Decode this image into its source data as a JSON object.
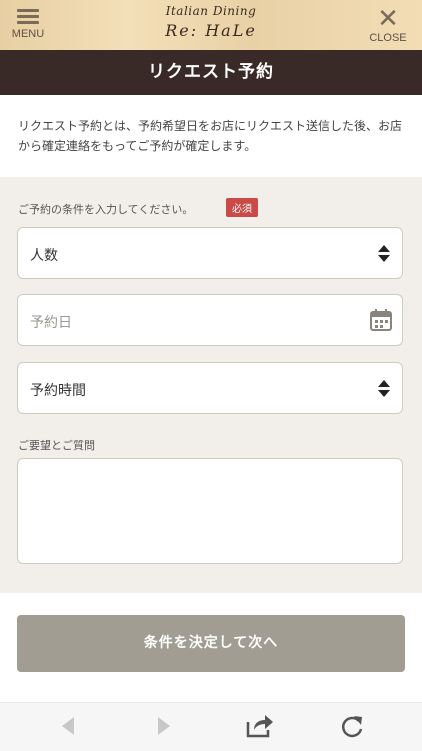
{
  "header": {
    "menu_label": "MENU",
    "logo_line1": "Italian Dining",
    "logo_line2": "Re: HaLe",
    "close_label": "CLOSE"
  },
  "page_title": "リクエスト予約",
  "intro_text": "リクエスト予約とは、予約希望日をお店にリクエスト送信した後、お店から確定連絡をもってご予約が確定します。",
  "form": {
    "conditions_label": "ご予約の条件を入力してください。",
    "required_badge": "必須",
    "people_select": "人数",
    "date_placeholder": "予約日",
    "time_select": "予約時間",
    "requests_label": "ご要望とご質問",
    "requests_value": ""
  },
  "submit_label": "条件を決定して次へ",
  "browser_nav": {
    "icons": [
      "back-arrow-icon",
      "forward-arrow-icon",
      "share-icon",
      "reload-icon"
    ]
  },
  "colors": {
    "title_bar": "#3a2a27",
    "required": "#c94a46",
    "submit_bg": "#a19d93",
    "form_bg": "#f2efea"
  }
}
